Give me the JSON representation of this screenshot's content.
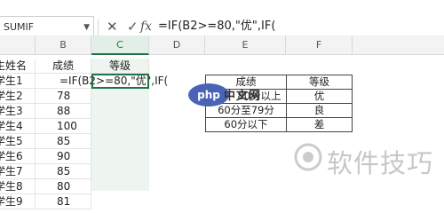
{
  "formula_bar": {
    "name_box": "SUMIF",
    "cancel_icon": "close-icon",
    "confirm_icon": "check-icon",
    "fx_label": "fx",
    "formula": "=IF(B2>=80,\"优\",IF("
  },
  "columns": [
    "B",
    "C",
    "D",
    "E",
    "F"
  ],
  "sheet": {
    "a_col": [
      "生姓名",
      "学生1",
      "学生2",
      "学生3",
      "学生4",
      "学生5",
      "学生6",
      "学生7",
      "学生8",
      "学生9"
    ],
    "b_col": [
      "成绩",
      "",
      "78",
      "88",
      "100",
      "85",
      "90",
      "85",
      "80",
      "81"
    ],
    "c_header": "等级",
    "editing_text": "=IF(B2>=80,\"优\",IF("
  },
  "lookup_table": {
    "headers": [
      "成绩",
      "等级"
    ],
    "rows": [
      [
        "80分以上",
        "优"
      ],
      [
        "60分至79分",
        "良"
      ],
      [
        "60分以下",
        "差"
      ]
    ]
  },
  "overlay": {
    "logo_text": "php",
    "logo_cn": "中文网",
    "watermark": "软件技巧"
  }
}
